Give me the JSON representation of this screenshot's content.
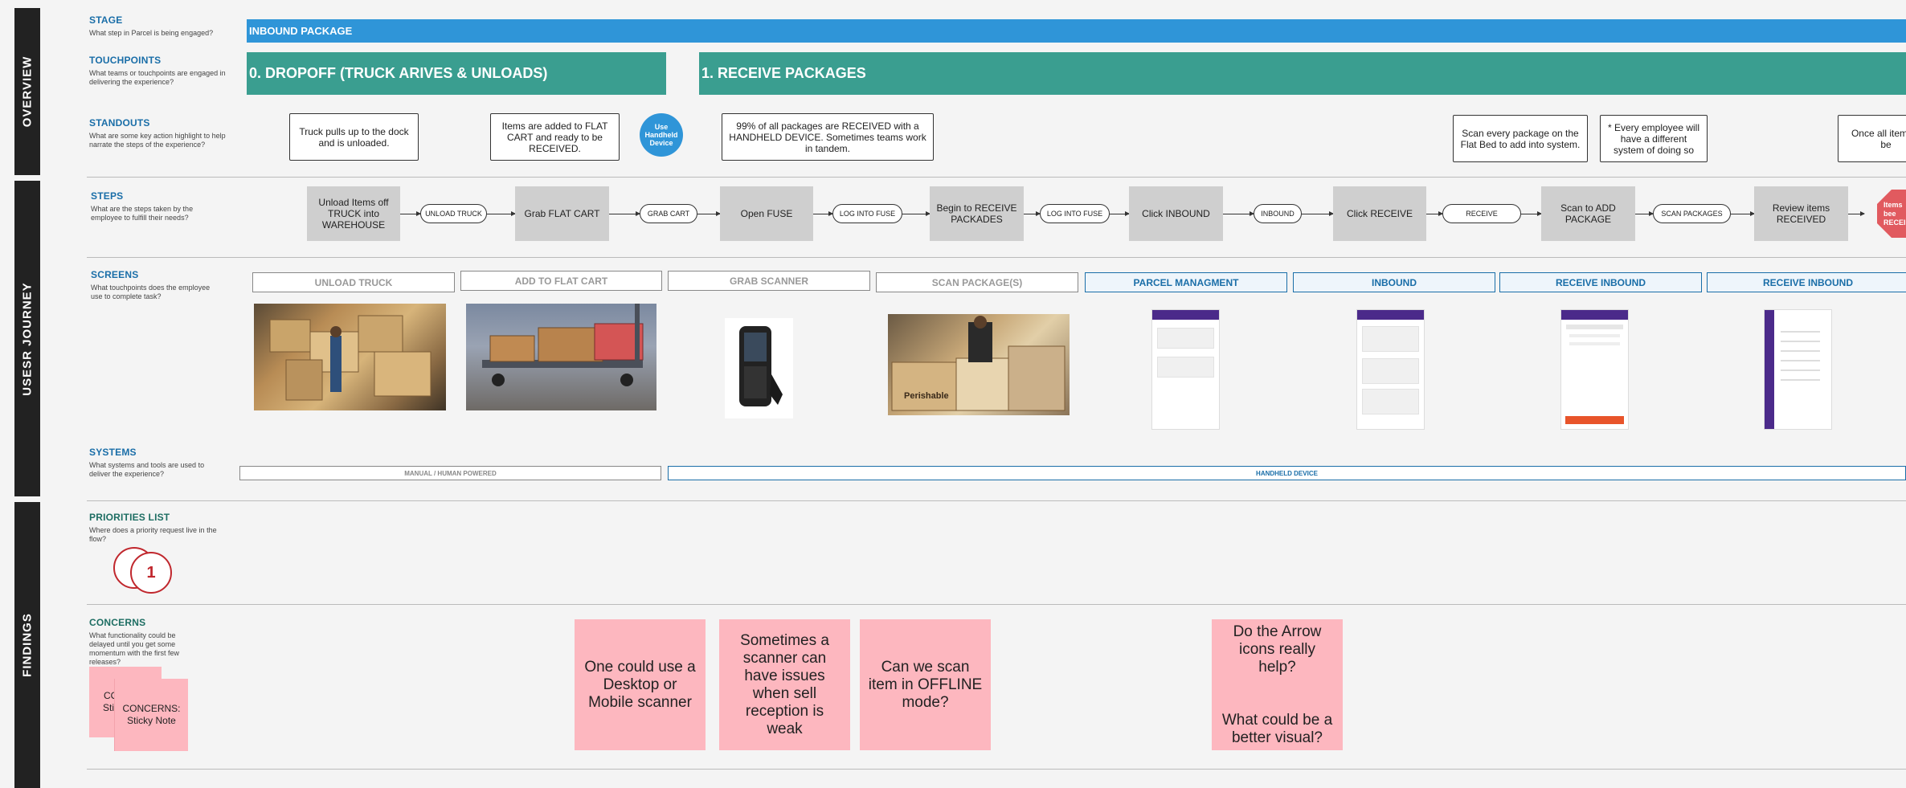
{
  "sidebar": [
    "OVERVIEW",
    "USESR JOURNEY",
    "FINDINGS"
  ],
  "rows": {
    "stage": {
      "title": "STAGE",
      "sub": "What step in Parcel is being engaged?"
    },
    "touchpoints": {
      "title": "TOUCHPOINTS",
      "sub": "What teams or touchpoints are engaged in delivering the experience?"
    },
    "standouts": {
      "title": "STANDOUTS",
      "sub": "What are some key action highlight to help narrate the steps of the experience?"
    },
    "steps": {
      "title": "STEPS",
      "sub": "What are the steps taken by the employee to fulfill their needs?"
    },
    "screens": {
      "title": "SCREENS",
      "sub": "What touchpoints does the employee use to complete task?"
    },
    "systems": {
      "title": "SYSTEMS",
      "sub": "What systems and tools are used to deliver the experience?"
    },
    "priorities": {
      "title": "PRIORITIES LIST",
      "sub": "Where does a priority request live in the flow?"
    },
    "concerns": {
      "title": "CONCERNS",
      "sub": "What functionality could be delayed until you get some momentum with the first few releases?"
    }
  },
  "stage_bar": "INBOUND PACKAGE",
  "touchpoint_bars": [
    "0. DROPOFF (TRUCK ARIVES & UNLOADS)",
    "1. RECEIVE PACKAGES"
  ],
  "standouts": [
    "Truck pulls up to the dock and is unloaded.",
    "Items are added to FLAT CART and ready to be RECEIVED.",
    "99% of all packages are RECEIVED with a HANDHELD DEVICE. Sometimes teams work in tandem.",
    "Scan every package on the Flat Bed to add into system.",
    "* Every employee will have a different system of doing so",
    "Once all items a be"
  ],
  "standout_circle": "Use Handheld Device",
  "steps": [
    "Unload Items off TRUCK into WAREHOUSE",
    "Grab FLAT CART",
    "Open FUSE",
    "Begin to RECEIVE PACKADES",
    "Click INBOUND",
    "Click RECEIVE",
    "Scan to ADD PACKAGE",
    "Review items RECEIVED"
  ],
  "step_pills": [
    "UNLOAD TRUCK",
    "GRAB CART",
    "LOG INTO FUSE",
    "LOG INTO FUSE",
    "INBOUND",
    "RECEIVE",
    "SCAN PACKAGES"
  ],
  "step_tail": "Items bee RECEI",
  "screens": [
    "UNLOAD TRUCK",
    "ADD TO FLAT CART",
    "GRAB SCANNER",
    "SCAN PACKAGE(S)",
    "PARCEL MANAGMENT",
    "INBOUND",
    "RECEIVE INBOUND",
    "RECEIVE INBOUND"
  ],
  "systems": [
    "MANUAL / HUMAN POWERED",
    "HANDHELD DEVICE"
  ],
  "priority_number": "1",
  "concern_sticky_left": [
    "CO Stic",
    "CONCERNS: Sticky Note"
  ],
  "concern_notes": [
    "One could use a Desktop or Mobile scanner",
    "Sometimes a scanner can have issues when sell reception is weak",
    "Can we scan item in OFFLINE mode?",
    "Do the Arrow icons really help?\n\n\nWhat could be a better visual?"
  ],
  "colors": {
    "stage_blue": "#2f95d8",
    "teal": "#3a9e90",
    "sticky_pink": "#fdb7bf",
    "priority_red": "#c0272d"
  }
}
